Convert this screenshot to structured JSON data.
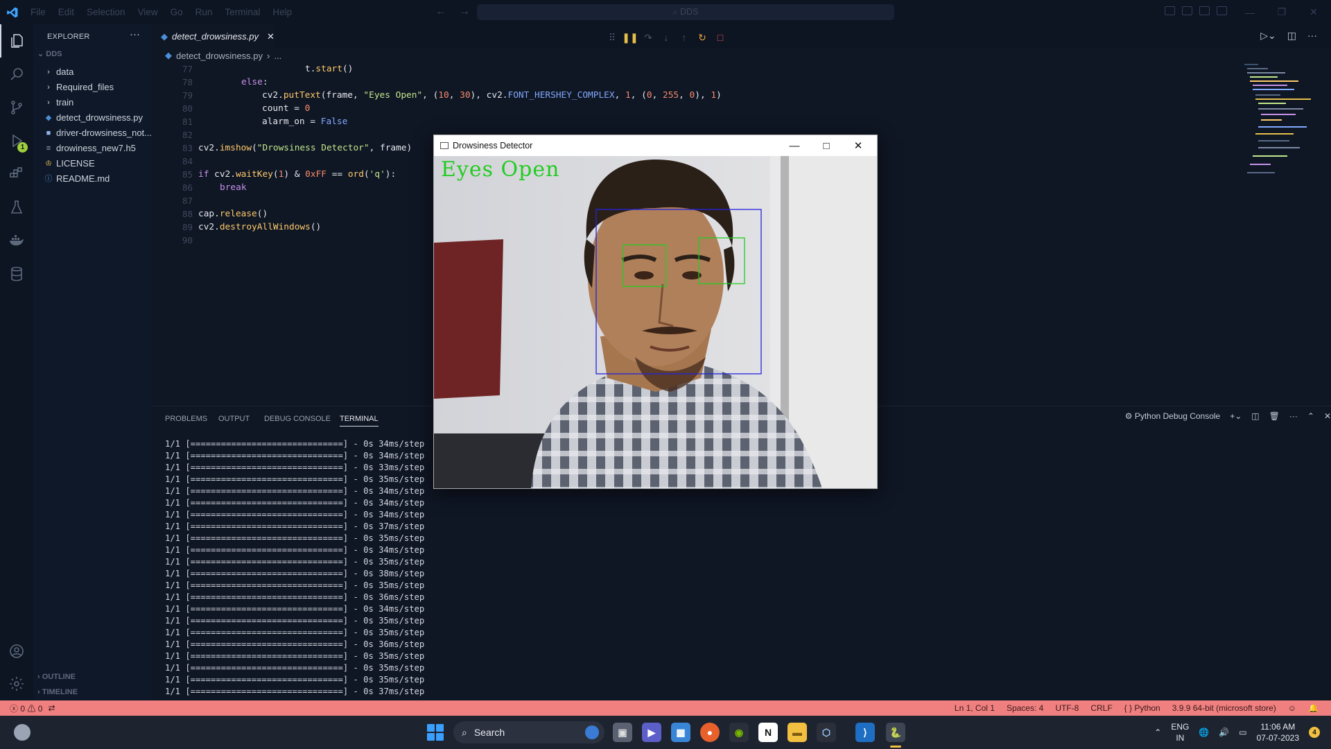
{
  "titlebar": {
    "menu": [
      "File",
      "Edit",
      "Selection",
      "View",
      "Go",
      "Run",
      "Terminal",
      "Help"
    ],
    "search_text": "DDS"
  },
  "activity": {
    "icons": [
      "explorer-icon",
      "search-icon",
      "source-control-icon",
      "run-debug-icon",
      "extensions-icon",
      "testing-icon",
      "docker-icon",
      "database-icon"
    ],
    "debug_badge": "1",
    "bottom_icons": [
      "account-icon",
      "settings-gear-icon"
    ]
  },
  "sidebar": {
    "title": "EXPLORER",
    "more": "···",
    "folder": "DDS",
    "items": [
      {
        "label": "data",
        "type": "folder"
      },
      {
        "label": "Required_files",
        "type": "folder"
      },
      {
        "label": "train",
        "type": "folder"
      },
      {
        "label": "detect_drowsiness.py",
        "type": "python"
      },
      {
        "label": "driver-drowsiness_not...",
        "type": "notebook"
      },
      {
        "label": "drowiness_new7.h5",
        "type": "file"
      },
      {
        "label": "LICENSE",
        "type": "license"
      },
      {
        "label": "README.md",
        "type": "info"
      }
    ],
    "outline": "OUTLINE",
    "timeline": "TIMELINE"
  },
  "editor": {
    "tab_label": "detect_drowsiness.py",
    "breadcrumb_file": "detect_drowsiness.py",
    "breadcrumb_rest": "...",
    "line_numbers": [
      "77",
      "78",
      "79",
      "80",
      "81",
      "82",
      "83",
      "84",
      "85",
      "86",
      "87",
      "88",
      "89",
      "90"
    ]
  },
  "panel": {
    "tabs": [
      "PROBLEMS",
      "OUTPUT",
      "DEBUG CONSOLE",
      "TERMINAL"
    ],
    "active_tab": "TERMINAL",
    "terminal_name": "Python Debug Console",
    "terminal_lines": [
      "1/1 [==============================] - 0s 34ms/step",
      "1/1 [==============================] - 0s 34ms/step",
      "1/1 [==============================] - 0s 33ms/step",
      "1/1 [==============================] - 0s 35ms/step",
      "1/1 [==============================] - 0s 34ms/step",
      "1/1 [==============================] - 0s 34ms/step",
      "1/1 [==============================] - 0s 34ms/step",
      "1/1 [==============================] - 0s 37ms/step",
      "1/1 [==============================] - 0s 35ms/step",
      "1/1 [==============================] - 0s 34ms/step",
      "1/1 [==============================] - 0s 35ms/step",
      "1/1 [==============================] - 0s 38ms/step",
      "1/1 [==============================] - 0s 35ms/step",
      "1/1 [==============================] - 0s 36ms/step",
      "1/1 [==============================] - 0s 34ms/step",
      "1/1 [==============================] - 0s 35ms/step",
      "1/1 [==============================] - 0s 35ms/step",
      "1/1 [==============================] - 0s 36ms/step",
      "1/1 [==============================] - 0s 35ms/step",
      "1/1 [==============================] - 0s 35ms/step",
      "1/1 [==============================] - 0s 35ms/step",
      "1/1 [==============================] - 0s 37ms/step"
    ]
  },
  "statusbar": {
    "errors": "0",
    "warnings": "0",
    "position": "Ln 1, Col 1",
    "spaces": "Spaces: 4",
    "encoding": "UTF-8",
    "eol": "CRLF",
    "language": "Python",
    "interpreter": "3.9.9 64-bit (microsoft store)"
  },
  "cv_window": {
    "title": "Drowsiness Detector",
    "overlay_text": "Eyes Open"
  },
  "taskbar": {
    "search_label": "Search",
    "lang_top": "ENG",
    "lang_bottom": "IN",
    "time": "11:06 AM",
    "date": "07-07-2023",
    "notification_count": "4"
  },
  "colors": {
    "statusbar": "#f08080",
    "editor_bg": "#0f1624",
    "accent": "#3ea6ff",
    "face_box": "#2222dd",
    "eye_box": "#22cc22"
  }
}
